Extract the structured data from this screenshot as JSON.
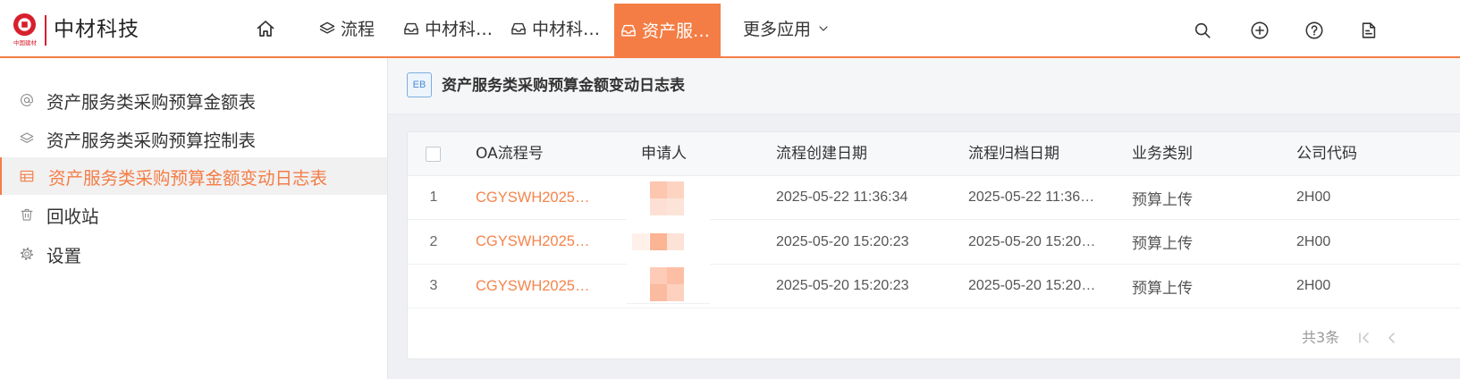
{
  "theme": {
    "accent": "#f47d45",
    "link": "#f5844c",
    "brand": "#d7202d"
  },
  "brand": {
    "logo_caption": "中国建材",
    "name": "中材科技"
  },
  "nav": {
    "home_icon": "home-icon",
    "items": [
      {
        "label": "流程",
        "icon": "layers-icon",
        "active": false
      },
      {
        "label": "中材科…",
        "icon": "inbox-icon",
        "active": false
      },
      {
        "label": "中材科…",
        "icon": "inbox-icon",
        "active": false
      },
      {
        "label": "资产服…",
        "icon": "inbox-icon",
        "active": true
      }
    ],
    "more": {
      "label": "更多应用",
      "icon": "chevron-down-icon"
    }
  },
  "toolbar": {
    "icons": [
      "search-icon",
      "plus-circle-icon",
      "help-circle-icon",
      "document-list-icon"
    ]
  },
  "sidebar": {
    "items": [
      {
        "label": "资产服务类采购预算金额表",
        "icon": "at-sign-icon",
        "active": false
      },
      {
        "label": "资产服务类采购预算控制表",
        "icon": "layers-icon",
        "active": false
      },
      {
        "label": "资产服务类采购预算金额变动日志表",
        "icon": "table-icon",
        "active": true
      },
      {
        "label": "回收站",
        "icon": "trash-icon",
        "active": false
      },
      {
        "label": "设置",
        "icon": "gear-icon",
        "active": false
      }
    ]
  },
  "page": {
    "badge": "EB",
    "title": "资产服务类采购预算金额变动日志表"
  },
  "table": {
    "columns": [
      "OA流程号",
      "申请人",
      "流程创建日期",
      "流程归档日期",
      "业务类别",
      "公司代码"
    ],
    "rows": [
      {
        "index": "1",
        "oa_no": "CGYSWH2025…",
        "created": "2025-05-22 11:36:34",
        "archived": "2025-05-22 11:36…",
        "category": "预算上传",
        "company_code": "2H00"
      },
      {
        "index": "2",
        "oa_no": "CGYSWH2025…",
        "created": "2025-05-20 15:20:23",
        "archived": "2025-05-20 15:20…",
        "category": "预算上传",
        "company_code": "2H00"
      },
      {
        "index": "3",
        "oa_no": "CGYSWH2025…",
        "created": "2025-05-20 15:20:23",
        "archived": "2025-05-20 15:20…",
        "category": "预算上传",
        "company_code": "2H00"
      }
    ]
  },
  "pagination": {
    "total_text": "共3条",
    "icons": [
      "first-page-icon",
      "prev-page-icon"
    ]
  }
}
